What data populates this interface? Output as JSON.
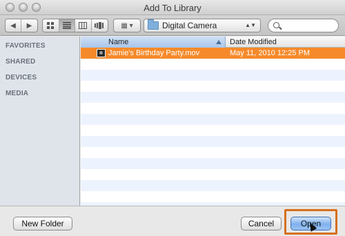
{
  "window": {
    "title": "Add To Library"
  },
  "toolbar": {
    "back": "◀",
    "forward": "▶",
    "view_icons": [
      "icon-view",
      "list-view",
      "column-view",
      "coverflow-view"
    ],
    "arrange": "▦ ▾",
    "location": "Digital Camera",
    "location_arrows": "▲▼",
    "search_placeholder": ""
  },
  "sidebar": {
    "sections": [
      "FAVORITES",
      "SHARED",
      "DEVICES",
      "MEDIA"
    ]
  },
  "list": {
    "columns": {
      "name": "Name",
      "date": "Date Modified"
    },
    "rows": [
      {
        "name": "Jamie's Birthday Party.mov",
        "date": "May 11, 2010 12:25 PM",
        "selected": true
      }
    ]
  },
  "buttons": {
    "new_folder": "New Folder",
    "cancel": "Cancel",
    "open": "Open"
  },
  "colors": {
    "selection": "#f68a2b",
    "highlight_box": "#d6701b",
    "default_button": "#7fb0ee"
  }
}
